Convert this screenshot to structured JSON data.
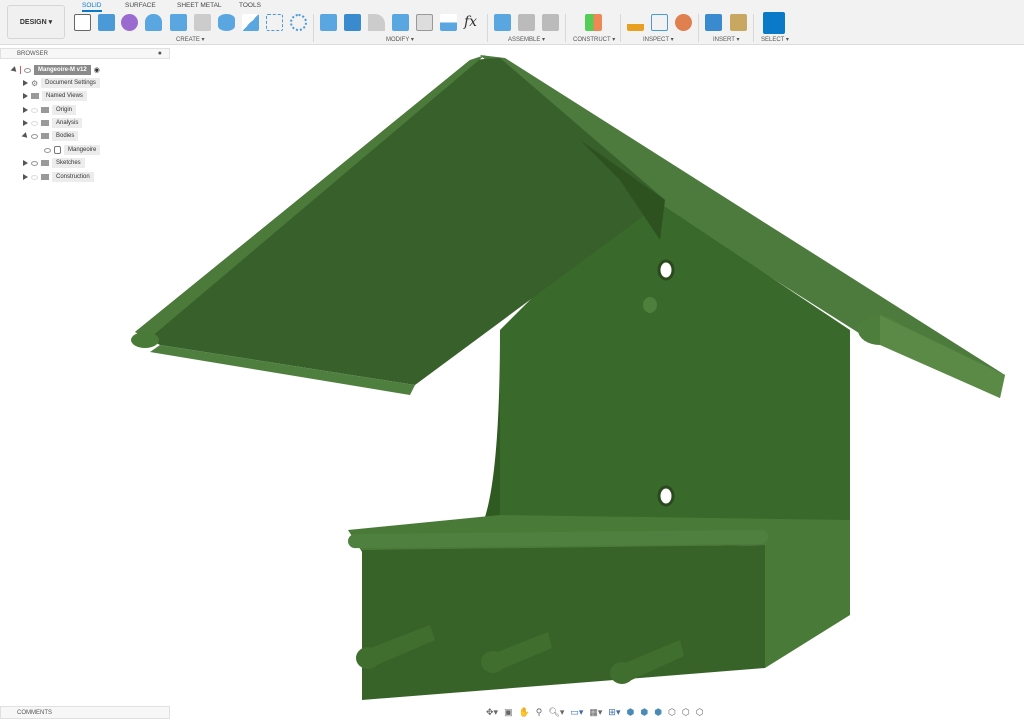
{
  "toolbar": {
    "workspace": "DESIGN ▾",
    "tabs": [
      "SOLID",
      "SURFACE",
      "SHEET METAL",
      "TOOLS"
    ],
    "groups": [
      "CREATE ▾",
      "MODIFY ▾",
      "ASSEMBLE ▾",
      "CONSTRUCT ▾",
      "INSPECT ▾",
      "INSERT ▾",
      "SELECT ▾"
    ]
  },
  "browser": {
    "title": "BROWSER",
    "root": "Mangeoire-M v12",
    "items": [
      "Document Settings",
      "Named Views",
      "Origin",
      "Analysis",
      "Bodies",
      "Mangeoire",
      "Sketches",
      "Construction"
    ]
  },
  "comments": {
    "title": "COMMENTS"
  },
  "navbar": {
    "icons": [
      "orbit-icon",
      "look-at-icon",
      "pan-icon",
      "zoom-window-icon",
      "zoom-icon",
      "display-settings-icon",
      "grid-icon",
      "viewports-icon",
      "shaded-icon",
      "shaded-edges-icon",
      "hidden-edges-icon",
      "visible-edges-icon",
      "wireframe-icon",
      "wireframe-hidden-icon"
    ]
  },
  "colors": {
    "model": "#3f6b30",
    "accent": "#0a7ac8"
  }
}
